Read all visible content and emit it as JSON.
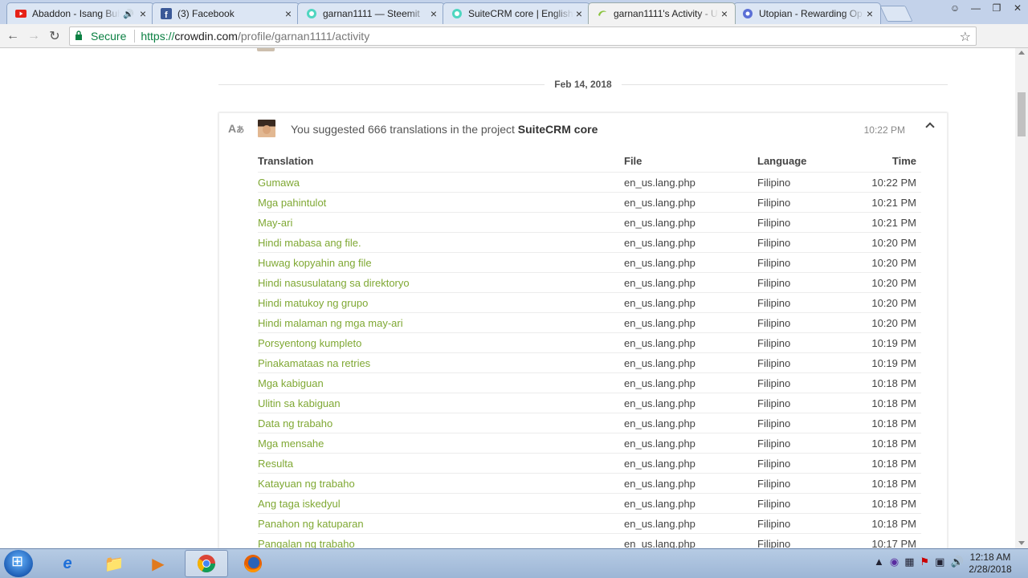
{
  "browser": {
    "tabs": [
      {
        "title": "Abaddon - Isang Buhay",
        "icon": "youtube-icon",
        "audio": true,
        "active": false
      },
      {
        "title": "(3) Facebook",
        "icon": "facebook-icon",
        "active": false
      },
      {
        "title": "garnan1111 — Steemit",
        "icon": "steemit-icon",
        "active": false
      },
      {
        "title": "SuiteCRM core | English t",
        "icon": "steemit-icon",
        "active": false
      },
      {
        "title": "garnan1111's Activity - U",
        "icon": "crowdin-icon",
        "active": true
      },
      {
        "title": "Utopian - Rewarding Op",
        "icon": "utopian-icon",
        "active": false
      }
    ],
    "address": {
      "secure_label": "Secure",
      "url_scheme": "https://",
      "url_host": "crowdin.com",
      "url_path": "/profile/garnan1111/activity"
    }
  },
  "activity": {
    "date": "Feb 14, 2018",
    "summary_prefix": "You suggested 666 translations in the project ",
    "project": "SuiteCRM core",
    "time": "10:22 PM",
    "columns": {
      "translation": "Translation",
      "file": "File",
      "language": "Language",
      "time": "Time"
    },
    "rows": [
      {
        "translation": "Gumawa",
        "file": "en_us.lang.php",
        "language": "Filipino",
        "time": "10:22 PM"
      },
      {
        "translation": "Mga pahintulot",
        "file": "en_us.lang.php",
        "language": "Filipino",
        "time": "10:21 PM"
      },
      {
        "translation": "May-ari",
        "file": "en_us.lang.php",
        "language": "Filipino",
        "time": "10:21 PM"
      },
      {
        "translation": "Hindi mabasa ang file.",
        "file": "en_us.lang.php",
        "language": "Filipino",
        "time": "10:20 PM"
      },
      {
        "translation": "Huwag kopyahin ang file",
        "file": "en_us.lang.php",
        "language": "Filipino",
        "time": "10:20 PM"
      },
      {
        "translation": "Hindi nasusulatang sa direktoryo",
        "file": "en_us.lang.php",
        "language": "Filipino",
        "time": "10:20 PM"
      },
      {
        "translation": "Hindi matukoy ng grupo",
        "file": "en_us.lang.php",
        "language": "Filipino",
        "time": "10:20 PM"
      },
      {
        "translation": "Hindi malaman ng mga may-ari",
        "file": "en_us.lang.php",
        "language": "Filipino",
        "time": "10:20 PM"
      },
      {
        "translation": "Porsyentong kumpleto",
        "file": "en_us.lang.php",
        "language": "Filipino",
        "time": "10:19 PM"
      },
      {
        "translation": "Pinakamataas na retries",
        "file": "en_us.lang.php",
        "language": "Filipino",
        "time": "10:19 PM"
      },
      {
        "translation": "Mga kabiguan",
        "file": "en_us.lang.php",
        "language": "Filipino",
        "time": "10:18 PM"
      },
      {
        "translation": "Ulitin sa kabiguan",
        "file": "en_us.lang.php",
        "language": "Filipino",
        "time": "10:18 PM"
      },
      {
        "translation": "Data ng trabaho",
        "file": "en_us.lang.php",
        "language": "Filipino",
        "time": "10:18 PM"
      },
      {
        "translation": "Mga mensahe",
        "file": "en_us.lang.php",
        "language": "Filipino",
        "time": "10:18 PM"
      },
      {
        "translation": "Resulta",
        "file": "en_us.lang.php",
        "language": "Filipino",
        "time": "10:18 PM"
      },
      {
        "translation": "Katayuan ng trabaho",
        "file": "en_us.lang.php",
        "language": "Filipino",
        "time": "10:18 PM"
      },
      {
        "translation": "Ang taga iskedyul",
        "file": "en_us.lang.php",
        "language": "Filipino",
        "time": "10:18 PM"
      },
      {
        "translation": "Panahon ng katuparan",
        "file": "en_us.lang.php",
        "language": "Filipino",
        "time": "10:18 PM"
      },
      {
        "translation": "Pangalan ng trabaho",
        "file": "en_us.lang.php",
        "language": "Filipino",
        "time": "10:17 PM"
      }
    ]
  },
  "taskbar": {
    "clock_time": "12:18 AM",
    "clock_date": "2/28/2018",
    "apps": [
      "windows-explorer-icon",
      "internet-explorer-icon",
      "file-explorer-icon",
      "media-player-icon",
      "chrome-icon",
      "firefox-icon"
    ]
  },
  "colors": {
    "translation_link": "#7fa833",
    "secure_green": "#0b8043"
  }
}
